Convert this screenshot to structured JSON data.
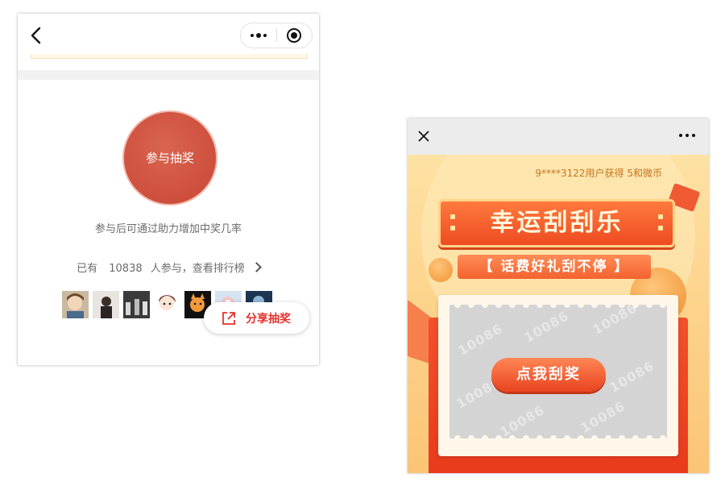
{
  "left_screen": {
    "nav": {
      "back_icon": "chevron-left-icon",
      "more_icon": "more-dots-icon",
      "close_icon": "target-circle-icon"
    },
    "join_button_label": "参与抽奖",
    "hint_text": "参与后可通过助力增加中奖几率",
    "participants": {
      "prefix": "已有",
      "count": "10838",
      "suffix": "人参与，查看排行榜"
    },
    "avatars": [
      "avatar-1",
      "avatar-2",
      "avatar-3",
      "avatar-4",
      "avatar-5",
      "avatar-6",
      "avatar-7"
    ],
    "share_button": {
      "icon": "share-external-icon",
      "label": "分享抽奖"
    },
    "colors": {
      "primary_red": "#c94534",
      "share_red": "#e5322d"
    }
  },
  "right_screen": {
    "top_bar": {
      "close_icon": "close-icon",
      "more_icon": "more-dots-icon"
    },
    "ticker_text": "9****3122用户获得 5和微币",
    "title": "幸运刮刮乐",
    "subtitle": "【 话费好礼刮不停 】",
    "scratch_button_label": "点我刮奖",
    "watermark_text": "10086",
    "colors": {
      "banner_orange": "#ee4b21",
      "background_yellow": "#fdd48d"
    }
  }
}
